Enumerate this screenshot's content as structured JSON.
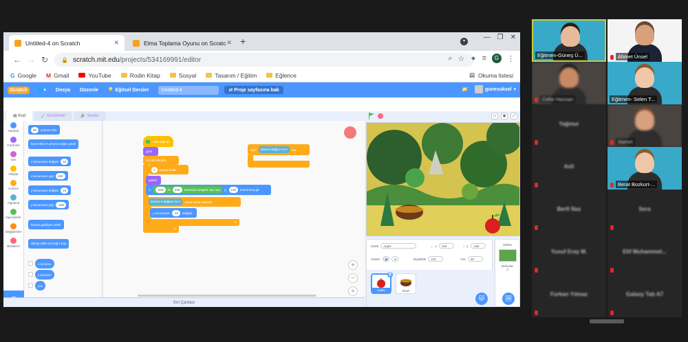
{
  "browser": {
    "tabs": [
      {
        "title": "Untitled-4 on Scratch",
        "active": true
      },
      {
        "title": "Elma Toplama Oyunu on Scratch",
        "active": false
      }
    ],
    "url_host": "scratch.mit.edu",
    "url_path": "/projects/534169991/editor",
    "profile_initial": "G",
    "bookmarks": [
      {
        "label": "Google",
        "icon": "google-icon"
      },
      {
        "label": "Gmail",
        "icon": "gmail-icon"
      },
      {
        "label": "YouTube",
        "icon": "youtube-icon"
      },
      {
        "label": "Rodin Kitap",
        "icon": "folder-icon"
      },
      {
        "label": "Sosyal",
        "icon": "folder-icon"
      },
      {
        "label": "Tasarım / Eğitim",
        "icon": "folder-icon"
      },
      {
        "label": "Eğlence",
        "icon": "folder-icon"
      }
    ],
    "reading_list": "Okuma listesi"
  },
  "scratch": {
    "logo": "Scratch",
    "menu": [
      "Dosya",
      "Düzenle",
      "Eğitsel Dersler"
    ],
    "project_title": "Untitled-4",
    "share_button": "Proje sayfasına bak",
    "username": "gunesuksel",
    "editor_tabs": [
      "Kod",
      "Kostümler",
      "Sesler"
    ],
    "categories": [
      {
        "label": "Hareket",
        "color": "#4c97ff"
      },
      {
        "label": "Görünüm",
        "color": "#9966ff"
      },
      {
        "label": "Ses",
        "color": "#cf63cf"
      },
      {
        "label": "Olaylar",
        "color": "#ffbf00"
      },
      {
        "label": "Kontrol",
        "color": "#ffab19"
      },
      {
        "label": "Algılama",
        "color": "#5cb1d6"
      },
      {
        "label": "Operatörler",
        "color": "#59c059"
      },
      {
        "label": "Değişkenler",
        "color": "#ff8c1a"
      },
      {
        "label": "Bloklarım",
        "color": "#ff6680"
      }
    ],
    "palette": [
      {
        "text": "yönüne dön",
        "value": "90"
      },
      {
        "text": "fare-imleci ▾ yönüne doğru yönel",
        "value": ""
      },
      {
        "text": "x konumunu değiştir",
        "value": "10"
      },
      {
        "text": "x konumunu yap",
        "value": "163"
      },
      {
        "text": "y konumunu değiştir",
        "value": "10"
      },
      {
        "text": "y konumunu yap",
        "value": "-156"
      },
      {
        "text": "kenara geldiyse sektir",
        "value": ""
      },
      {
        "text": "dönüş stilini sol-sağ ▾ yap",
        "value": ""
      },
      {
        "text": "x konumu",
        "value": ""
      },
      {
        "text": "y konumu",
        "value": ""
      },
      {
        "text": "yön",
        "value": ""
      }
    ],
    "script1": {
      "hat": "tıklandığında",
      "hide": "gizle",
      "forever": "sürekli tekrarla",
      "wait_label": "saniye bekle",
      "wait_value": "1",
      "show": "göster",
      "goto_x_label": "x:",
      "rand_from": "-230",
      "rand_to": "230",
      "rand_text1": "ile",
      "rand_text2": "arasında rastgele sayı seç",
      "goto_y_label": "y:",
      "goto_y": "140",
      "goto_suffix": "konumuna git",
      "repeat_until": "olana kadar tekrarla",
      "touching": "kenara ▾ değiyor mu?",
      "change_y": "y konumunu",
      "change_y_value": "-10",
      "change_y_suffix": "değiştir"
    },
    "script2": {
      "if": "eğer",
      "touching": "Bowl ▾ değiyor mu?",
      "then": "ise"
    },
    "sprite": {
      "label_sprite": "Kukla",
      "name": "Apple",
      "x": "163",
      "y": "-156",
      "show_label": "Göster",
      "size_label": "Büyüklük",
      "size": "100",
      "direction_label": "Yön",
      "direction": "90"
    },
    "sprites": [
      {
        "name": "Apple",
        "selected": true
      },
      {
        "name": "Bowl",
        "selected": false
      }
    ],
    "stage_pane": {
      "label": "Sahne",
      "backdrops_label": "Dekorlar",
      "backdrops_count": "3"
    },
    "backpack": "Sırt Çantası"
  },
  "participants": [
    {
      "name": "Eğitmen-Güneş Ü...",
      "video": true,
      "muted": false
    },
    {
      "name": "Ahmet Ünsel",
      "video": true,
      "muted": true
    },
    {
      "name": "Cebe Hassan",
      "video": true,
      "muted": true
    },
    {
      "name": "Eğitmen- Selen T...",
      "video": true,
      "muted": false
    },
    {
      "name": "Yağmur",
      "video": false,
      "muted": true
    },
    {
      "name": "Samet",
      "video": true,
      "muted": true
    },
    {
      "name": "Asli",
      "video": false,
      "muted": true
    },
    {
      "name": "Berat Bozkurt-...",
      "video": true,
      "muted": true
    },
    {
      "name": "Berfi Naz",
      "video": false,
      "muted": true
    },
    {
      "name": "Sera",
      "video": false,
      "muted": true
    },
    {
      "name": "Yusuf Eray M.",
      "video": false,
      "muted": true
    },
    {
      "name": "Elif Muhammet...",
      "video": false,
      "muted": true
    },
    {
      "name": "Furkan Yılmaz",
      "video": false,
      "muted": true
    },
    {
      "name": "Galaxy Tab A7",
      "video": false,
      "muted": true
    }
  ]
}
